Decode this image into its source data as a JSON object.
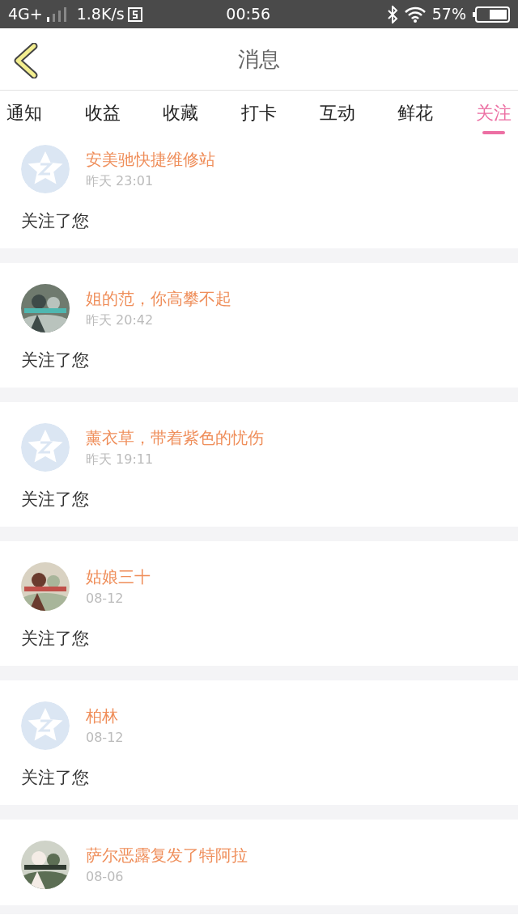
{
  "status_bar": {
    "network": "4G+",
    "speed": "1.8K/s",
    "time": "00:56",
    "battery": "57%"
  },
  "header": {
    "title": "消息"
  },
  "tabs": [
    {
      "label": "通知",
      "selected": false
    },
    {
      "label": "收益",
      "selected": false
    },
    {
      "label": "收藏",
      "selected": false
    },
    {
      "label": "打卡",
      "selected": false
    },
    {
      "label": "互动",
      "selected": false
    },
    {
      "label": "鲜花",
      "selected": false
    },
    {
      "label": "关注",
      "selected": true
    }
  ],
  "notifications": [
    {
      "kind": "default",
      "name": "安美驰快捷维修站",
      "time": "昨天 23:01",
      "message": "关注了您"
    },
    {
      "kind": "picture",
      "name": "姐的范，你高攀不起",
      "time": "昨天 20:42",
      "message": "关注了您"
    },
    {
      "kind": "default",
      "name": "薰衣草，带着紫色的忧伤",
      "time": "昨天 19:11",
      "message": "关注了您"
    },
    {
      "kind": "picture",
      "name": "姑娘三十",
      "time": "08-12",
      "message": "关注了您"
    },
    {
      "kind": "default",
      "name": "柏林",
      "time": "08-12",
      "message": "关注了您"
    },
    {
      "kind": "picture",
      "name": "萨尔恶露复发了特阿拉",
      "time": "08-06"
    }
  ]
}
